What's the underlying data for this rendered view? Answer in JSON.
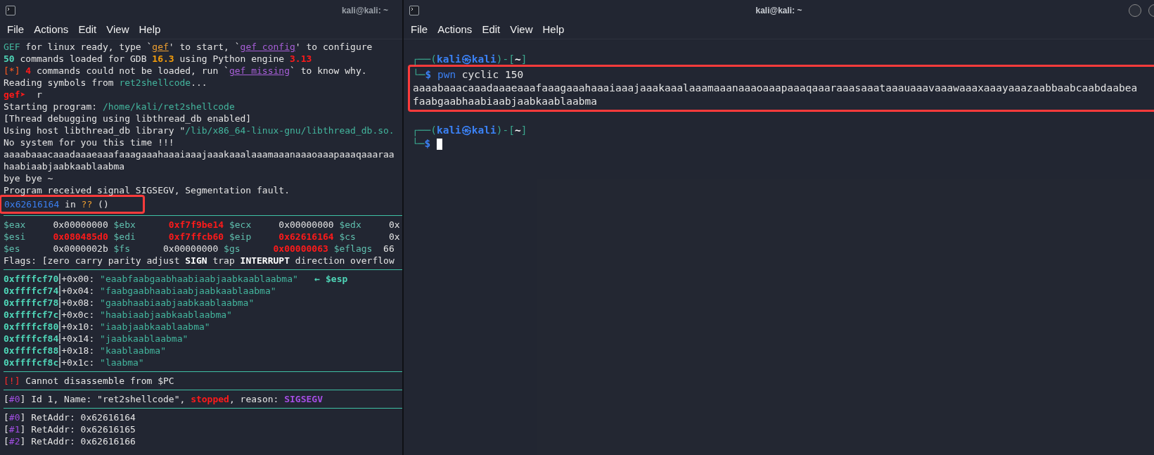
{
  "left_terminal": {
    "title": "kali@kali: ~",
    "menu": [
      "File",
      "Actions",
      "Edit",
      "View",
      "Help"
    ],
    "lines": [
      {
        "segments": [
          {
            "text": "GEF",
            "kind": "teal"
          },
          {
            "text": " for linux ready, type `",
            "kind": "plain"
          },
          {
            "text": "gef",
            "kind": "orange-link"
          },
          {
            "text": "' to start, `",
            "kind": "plain"
          },
          {
            "text": "gef config",
            "kind": "purple-link"
          },
          {
            "text": "' to configure",
            "kind": "plain"
          }
        ]
      },
      {
        "segments": [
          {
            "text": "50",
            "kind": "teal-bold"
          },
          {
            "text": " commands loaded for GDB ",
            "kind": "plain"
          },
          {
            "text": "16.3",
            "kind": "orange-bold"
          },
          {
            "text": " using Python engine ",
            "kind": "plain"
          },
          {
            "text": "3.13",
            "kind": "red-bold"
          }
        ]
      },
      {
        "segments": [
          {
            "text": "[*]",
            "kind": "orange-red"
          },
          {
            "text": " 4",
            "kind": "red-bold"
          },
          {
            "text": " commands could not be loaded, run `",
            "kind": "plain"
          },
          {
            "text": "gef missing",
            "kind": "purple-link"
          },
          {
            "text": "` to know why.",
            "kind": "plain"
          }
        ]
      },
      {
        "segments": [
          {
            "text": "Reading symbols from ",
            "kind": "plain"
          },
          {
            "text": "ret2shellcode",
            "kind": "teal"
          },
          {
            "text": "...",
            "kind": "plain"
          }
        ]
      },
      {
        "segments": [
          {
            "text": "gef➤",
            "kind": "red-bold"
          },
          {
            "text": "  r",
            "kind": "plain"
          }
        ]
      },
      {
        "segments": [
          {
            "text": "Starting program: ",
            "kind": "plain"
          },
          {
            "text": "/home/kali/ret2shellcode",
            "kind": "teal"
          }
        ]
      },
      {
        "segments": [
          {
            "text": "[Thread debugging using libthread_db enabled]",
            "kind": "plain"
          }
        ]
      },
      {
        "segments": [
          {
            "text": "Using host libthread_db library \"",
            "kind": "plain"
          },
          {
            "text": "/lib/x86_64-linux-gnu/libthread_db.so.",
            "kind": "teal"
          }
        ]
      },
      {
        "segments": [
          {
            "text": "No system for you this time !!!",
            "kind": "plain"
          }
        ]
      },
      {
        "segments": [
          {
            "text": "aaaabaaacaaadaaaeaaafaaagaaahaaaiaaajaaakaaalaaamaaanaaaoaaapaaaqaaaraa",
            "kind": "plain"
          }
        ]
      },
      {
        "segments": [
          {
            "text": "haabiaabjaabkaablaabma",
            "kind": "plain"
          }
        ]
      },
      {
        "segments": [
          {
            "text": "bye bye ~",
            "kind": "plain"
          }
        ]
      },
      {
        "segments": [
          {
            "text": "Program received signal SIGSEGV, Segmentation fault.",
            "kind": "plain"
          }
        ]
      },
      {
        "highlighted": true,
        "segments": [
          {
            "text": "0x62616164",
            "kind": "blue"
          },
          {
            "text": " in ",
            "kind": "plain"
          },
          {
            "text": "??",
            "kind": "orange"
          },
          {
            "text": " ()",
            "kind": "plain"
          }
        ]
      },
      {
        "kind": "rule"
      },
      {
        "segments": [
          {
            "text": "$eax",
            "kind": "reg"
          },
          {
            "text": "     0x00000000 ",
            "kind": "plain"
          },
          {
            "text": "$ebx",
            "kind": "reg"
          },
          {
            "text": "      0xf7f9be14",
            "kind": "red-bold"
          },
          {
            "text": " $ecx",
            "kind": "reg"
          },
          {
            "text": "     0x00000000 ",
            "kind": "plain"
          },
          {
            "text": "$edx",
            "kind": "reg"
          },
          {
            "text": "     0x",
            "kind": "plain"
          }
        ]
      },
      {
        "segments": [
          {
            "text": "$esi",
            "kind": "reg"
          },
          {
            "text": "     0x080485d0",
            "kind": "red-bold"
          },
          {
            "text": " $edi",
            "kind": "reg"
          },
          {
            "text": "      0xf7ffcb60",
            "kind": "red-bold"
          },
          {
            "text": " $eip",
            "kind": "reg"
          },
          {
            "text": "     0x62616164",
            "kind": "red-bold"
          },
          {
            "text": " $cs",
            "kind": "reg"
          },
          {
            "text": "      0x",
            "kind": "plain"
          }
        ]
      },
      {
        "segments": [
          {
            "text": "$es",
            "kind": "reg"
          },
          {
            "text": "      0x0000002b ",
            "kind": "plain"
          },
          {
            "text": "$fs",
            "kind": "reg"
          },
          {
            "text": "      0x00000000 ",
            "kind": "plain"
          },
          {
            "text": "$gs",
            "kind": "reg"
          },
          {
            "text": "      0x00000063",
            "kind": "red-bold"
          },
          {
            "text": " $eflags",
            "kind": "reg"
          },
          {
            "text": "  66",
            "kind": "plain"
          }
        ]
      },
      {
        "segments": [
          {
            "text": "Flags: [zero carry parity adjust ",
            "kind": "plain"
          },
          {
            "text": "SIGN",
            "kind": "white-bold"
          },
          {
            "text": " trap ",
            "kind": "plain"
          },
          {
            "text": "INTERRUPT",
            "kind": "white-bold"
          },
          {
            "text": " direction overflow",
            "kind": "plain"
          }
        ]
      },
      {
        "kind": "rule"
      },
      {
        "kind": "stack",
        "address": "0xffffcf70",
        "offset": "+0x00: ",
        "value": "\"eaabfaabgaabhaabiaabjaabkaablaabma\"",
        "note": "   ← $esp"
      },
      {
        "kind": "stack",
        "address": "0xffffcf74",
        "offset": "+0x04: ",
        "value": "\"faabgaabhaabiaabjaabkaablaabma\""
      },
      {
        "kind": "stack",
        "address": "0xffffcf78",
        "offset": "+0x08: ",
        "value": "\"gaabhaabiaabjaabkaablaabma\""
      },
      {
        "kind": "stack",
        "address": "0xffffcf7c",
        "offset": "+0x0c: ",
        "value": "\"haabiaabjaabkaablaabma\""
      },
      {
        "kind": "stack",
        "address": "0xffffcf80",
        "offset": "+0x10: ",
        "value": "\"iaabjaabkaablaabma\""
      },
      {
        "kind": "stack",
        "address": "0xffffcf84",
        "offset": "+0x14: ",
        "value": "\"jaabkaablaabma\""
      },
      {
        "kind": "stack",
        "address": "0xffffcf88",
        "offset": "+0x18: ",
        "value": "\"kaablaabma\""
      },
      {
        "kind": "stack",
        "address": "0xffffcf8c",
        "offset": "+0x1c: ",
        "value": "\"laabma\""
      },
      {
        "kind": "rule"
      },
      {
        "segments": [
          {
            "text": "[!]",
            "kind": "red"
          },
          {
            "text": " Cannot disassemble from $PC",
            "kind": "plain"
          }
        ]
      },
      {
        "kind": "rule"
      },
      {
        "segments": [
          {
            "text": "[",
            "kind": "plain"
          },
          {
            "text": "#0",
            "kind": "purple"
          },
          {
            "text": "] Id 1, Name: \"ret2shellcode\", ",
            "kind": "plain"
          },
          {
            "text": "stopped",
            "kind": "red-bold"
          },
          {
            "text": ", reason: ",
            "kind": "plain"
          },
          {
            "text": "SIGSEGV",
            "kind": "purple-bold"
          }
        ]
      },
      {
        "kind": "rule"
      },
      {
        "segments": [
          {
            "text": "[",
            "kind": "plain"
          },
          {
            "text": "#0",
            "kind": "purple"
          },
          {
            "text": "] RetAddr: 0x62616164",
            "kind": "plain"
          }
        ]
      },
      {
        "segments": [
          {
            "text": "[",
            "kind": "plain"
          },
          {
            "text": "#1",
            "kind": "purple"
          },
          {
            "text": "] RetAddr: 0x62616165",
            "kind": "plain"
          }
        ]
      },
      {
        "segments": [
          {
            "text": "[",
            "kind": "plain"
          },
          {
            "text": "#2",
            "kind": "purple"
          },
          {
            "text": "] RetAddr: 0x62616166",
            "kind": "plain"
          }
        ]
      }
    ]
  },
  "right_terminal": {
    "title": "kali@kali: ~",
    "menu": [
      "File",
      "Actions",
      "Edit",
      "View",
      "Help"
    ],
    "lines": [
      {
        "segments": [
          {
            "text": "┌──(",
            "kind": "green"
          },
          {
            "text": "kali㉿kali",
            "kind": "blue-bold"
          },
          {
            "text": ")-[",
            "kind": "green"
          },
          {
            "text": "~",
            "kind": "white-bold"
          },
          {
            "text": "]",
            "kind": "green"
          }
        ]
      },
      {
        "highlighted": true,
        "segments": [
          {
            "text": "└─",
            "kind": "green"
          },
          {
            "text": "$",
            "kind": "blue-bold"
          },
          {
            "text": " pwn",
            "kind": "blue"
          },
          {
            "text": " cyclic 150",
            "kind": "plain"
          }
        ]
      },
      {
        "highlighted": true,
        "segments": [
          {
            "text": "aaaabaaacaaadaaaeaaafaaagaaahaaaiaaajaaakaaalaaamaaanaaaoaaapaaaqaaaraaasaaataaauaaavaaawaaaxaaayaaazaabbaabcaabdaabea",
            "kind": "plain"
          }
        ]
      },
      {
        "highlighted": true,
        "segments": [
          {
            "text": "faabgaabhaabiaabjaabkaablaabma",
            "kind": "plain"
          }
        ]
      },
      {
        "kind": "blank"
      },
      {
        "segments": [
          {
            "text": "┌──(",
            "kind": "green"
          },
          {
            "text": "kali㉿kali",
            "kind": "blue-bold"
          },
          {
            "text": ")-[",
            "kind": "green"
          },
          {
            "text": "~",
            "kind": "white-bold"
          },
          {
            "text": "]",
            "kind": "green"
          }
        ]
      },
      {
        "cursor": true,
        "segments": [
          {
            "text": "└─",
            "kind": "green"
          },
          {
            "text": "$",
            "kind": "blue-bold"
          }
        ]
      }
    ]
  }
}
